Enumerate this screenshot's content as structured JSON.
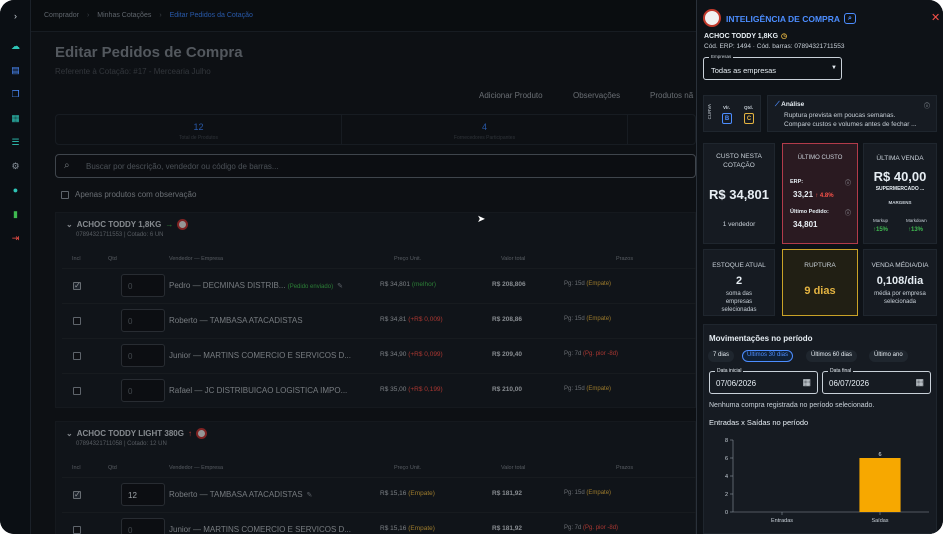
{
  "breadcrumb": {
    "items": [
      "Comprador",
      "Minhas Cotações",
      "Editar Pedidos da Cotação"
    ]
  },
  "page": {
    "title": "Editar Pedidos de Compra",
    "subtitle": "Referente à Cotação: #17 - Mercearia Julho"
  },
  "actions": {
    "add_product": "Adicionar Produto",
    "observations": "Observações",
    "products": "Produtos nã"
  },
  "stats": [
    {
      "value": "12",
      "label": "Total de Produtos"
    },
    {
      "value": "4",
      "label": "Fornecedores Participantes"
    }
  ],
  "search": {
    "placeholder": "Buscar por descrição, vendedor ou código de barras..."
  },
  "filter": {
    "only_with_obs": "Apenas produtos com observação"
  },
  "columns": {
    "incl": "Incl",
    "qty": "Qtd",
    "vendor": "Vendedor — Empresa",
    "price": "Preço Unit.",
    "total": "Valor total",
    "terms": "Prazos"
  },
  "groups": [
    {
      "name": "ACHOC TODDY 1,8KG",
      "trend": "→",
      "info": "07894321711553 | Cotado: 6 UN",
      "rows": [
        {
          "checked": true,
          "qty": "0",
          "vendor": "Pedro — DECMINAS DISTRIB...",
          "tag": "(Pedido enviado)",
          "price": "R$ 34,801",
          "price_note": "(melhor)",
          "total": "R$ 208,806",
          "terms": "Pg: 15d",
          "terms_note": "(Empate)",
          "cut": "07"
        },
        {
          "checked": false,
          "qty": "0",
          "vendor": "Roberto — TAMBASA ATACADISTAS",
          "tag": "",
          "price": "R$ 34,81",
          "price_note": "(+R$ 0,009)",
          "total": "R$ 208,86",
          "terms": "Pg: 15d",
          "terms_note": "(Empate)",
          "cut": "17"
        },
        {
          "checked": false,
          "qty": "0",
          "vendor": "Junior — MARTINS COMERCIO E SERVICOS D...",
          "tag": "",
          "price": "R$ 34,90",
          "price_note": "(+R$ 0,099)",
          "total": "R$ 209,40",
          "terms": "Pg: 7d",
          "terms_note": "(Pg. pior -8d)",
          "cut": "21"
        },
        {
          "checked": false,
          "qty": "0",
          "vendor": "Rafael — JC DISTRIBUICAO LOGISTICA IMPO...",
          "tag": "",
          "price": "R$ 35,00",
          "price_note": "(+R$ 0,199)",
          "total": "R$ 210,00",
          "terms": "Pg: 15d",
          "terms_note": "(Empate)",
          "cut": "07"
        }
      ]
    },
    {
      "name": "ACHOC TODDY LIGHT 380G",
      "trend": "↑",
      "info": "07894321711058 | Cotado: 12 UN",
      "rows": [
        {
          "checked": true,
          "qty": "12",
          "vendor": "Roberto — TAMBASA ATACADISTAS",
          "tag": "",
          "price": "R$ 15,16",
          "price_note": "(Empate)",
          "total": "R$ 181,92",
          "terms": "Pg: 15d",
          "terms_note": "(Empate)",
          "cut": "17"
        },
        {
          "checked": false,
          "qty": "0",
          "vendor": "Junior — MARTINS COMERCIO E SERVICOS D...",
          "tag": "",
          "price": "R$ 15,16",
          "price_note": "(Empate)",
          "total": "R$ 181,92",
          "terms": "Pg: 7d",
          "terms_note": "(Pg. pior -8d)",
          "cut": "21"
        }
      ]
    }
  ],
  "panel": {
    "title": "INTELIGÊNCIA DE COMPRA",
    "product": "ACHOC TODDY 1,8KG",
    "codes": "Cód. ERP: 1494 · Cód. barras: 07894321711553",
    "company_label": "Empresas",
    "company_value": "Todas as empresas",
    "curva": {
      "label": "CURVA",
      "vlr_label": "Vlr.",
      "vlr": "B",
      "qtd_label": "Qtd.",
      "qtd": "C"
    },
    "analysis": {
      "title": "Análise",
      "line1": "Ruptura prevista em poucas semanas.",
      "line2": "Compare custos e volumes antes de fechar ..."
    },
    "custo_cot": {
      "title": "CUSTO NESTA COTAÇÃO",
      "value": "R$ 34,801",
      "sub": "1 vendedor"
    },
    "ultimo_custo": {
      "title": "ÚLTIMO CUSTO",
      "erp_label": "ERP:",
      "erp_value": "33,21",
      "erp_delta": "↑ 4.8%",
      "ped_label": "Último Pedido:",
      "ped_value": "34,801"
    },
    "ultima_venda": {
      "title": "ÚLTIMA VENDA",
      "value": "R$ 40,00",
      "store": "SUPERMERCADO ...",
      "margins": "MARGENS",
      "markup_label": "Markup",
      "markup": "↑15%",
      "markdown_label": "Markdown",
      "markdown": "↑13%"
    },
    "estoque": {
      "title": "ESTOQUE ATUAL",
      "value": "2",
      "sub": "soma das empresas selecionadas"
    },
    "ruptura": {
      "title": "RUPTURA",
      "value": "9 dias"
    },
    "venda_media": {
      "title": "VENDA MÉDIA/DIA",
      "value": "0,108/dia",
      "sub": "média por empresa selecionada"
    },
    "movements": {
      "title": "Movimentações no período",
      "ranges": [
        "7 dias",
        "Últimos 30 dias",
        "Últimos 60 dias",
        "Último ano"
      ],
      "start_label": "Data inicial",
      "start": "07/06/2026",
      "end_label": "Data final",
      "end": "06/07/2026",
      "empty": "Nenhuma compra registrada no período selecionado.",
      "chart_title": "Entradas x Saídas no período"
    }
  },
  "chart_data": {
    "type": "bar",
    "title": "Entradas x Saídas no período",
    "categories": [
      "Entradas",
      "Saídas"
    ],
    "values": [
      0,
      6
    ],
    "ylim": [
      0,
      8
    ],
    "yticks": [
      0,
      2,
      4,
      6,
      8
    ],
    "data_labels": [
      "",
      "6"
    ],
    "bar_color": "#f7a800"
  },
  "colors": {
    "accent": "#3b82f6",
    "positive": "#3fb950",
    "negative": "#f85149",
    "warning": "#e3b341"
  }
}
